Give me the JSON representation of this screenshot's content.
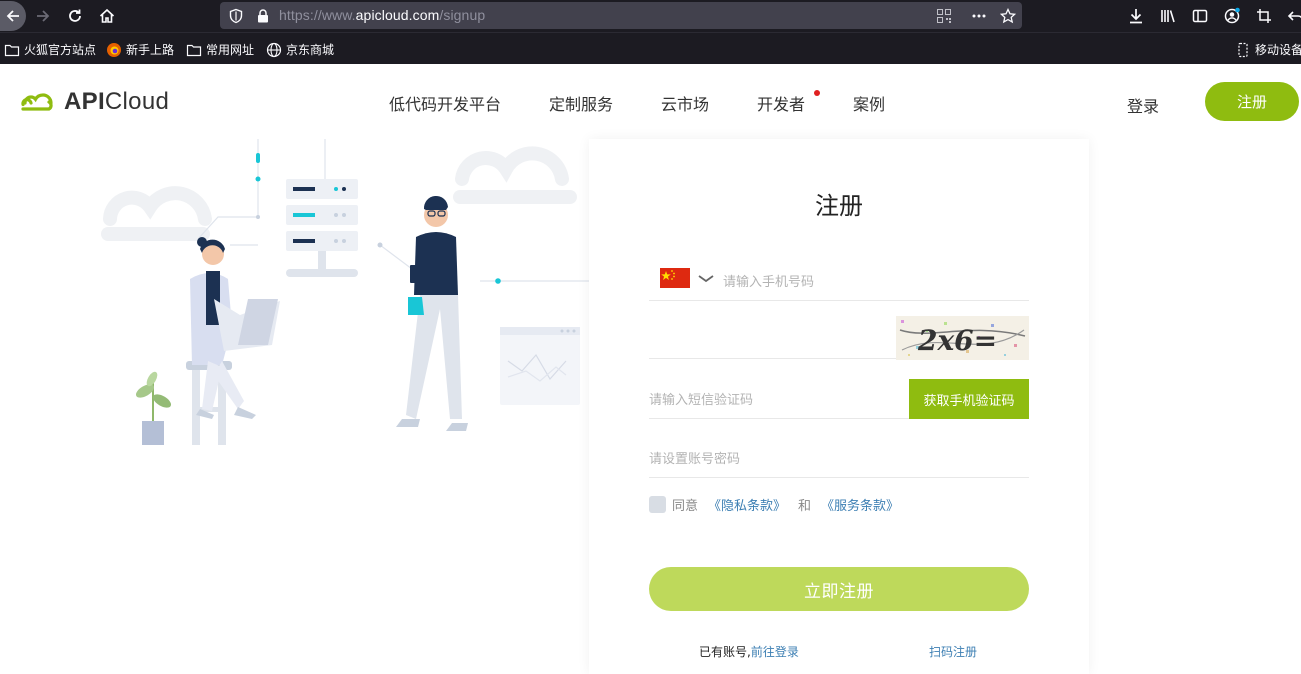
{
  "browser": {
    "url_prefix": "https://www.",
    "url_domain": "apicloud.com",
    "url_path": "/signup"
  },
  "bookmarks": [
    {
      "label": "火狐官方站点",
      "icon": "folder-icon"
    },
    {
      "label": "新手上路",
      "icon": "firefox-icon"
    },
    {
      "label": "常用网址",
      "icon": "folder-icon"
    },
    {
      "label": "京东商城",
      "icon": "globe-icon"
    }
  ],
  "bookmarks_right": {
    "label": "移动设备上",
    "icon": "mobile-icon"
  },
  "site": {
    "logo_api": "API",
    "logo_cloud": "Cloud",
    "brand_color": "#8fbc10",
    "nav": [
      {
        "label": "低代码开发平台"
      },
      {
        "label": "定制服务"
      },
      {
        "label": "云市场"
      },
      {
        "label": "开发者"
      },
      {
        "label": "案例"
      }
    ],
    "login": "登录",
    "signup": "注册"
  },
  "form": {
    "title": "注册",
    "phone_placeholder": "请输入手机号码",
    "country_flag": "china-flag-icon",
    "captcha_text": "2x6=",
    "sms_placeholder": "请输入短信验证码",
    "sms_button": "获取手机验证码",
    "password_placeholder": "请设置账号密码",
    "agree_prefix": "同意",
    "privacy_link": "《隐私条款》",
    "and": "和",
    "service_link": "《服务条款》",
    "submit": "立即注册",
    "has_account": "已有账号,",
    "go_login": "前往登录",
    "scan_register": "扫码注册"
  }
}
